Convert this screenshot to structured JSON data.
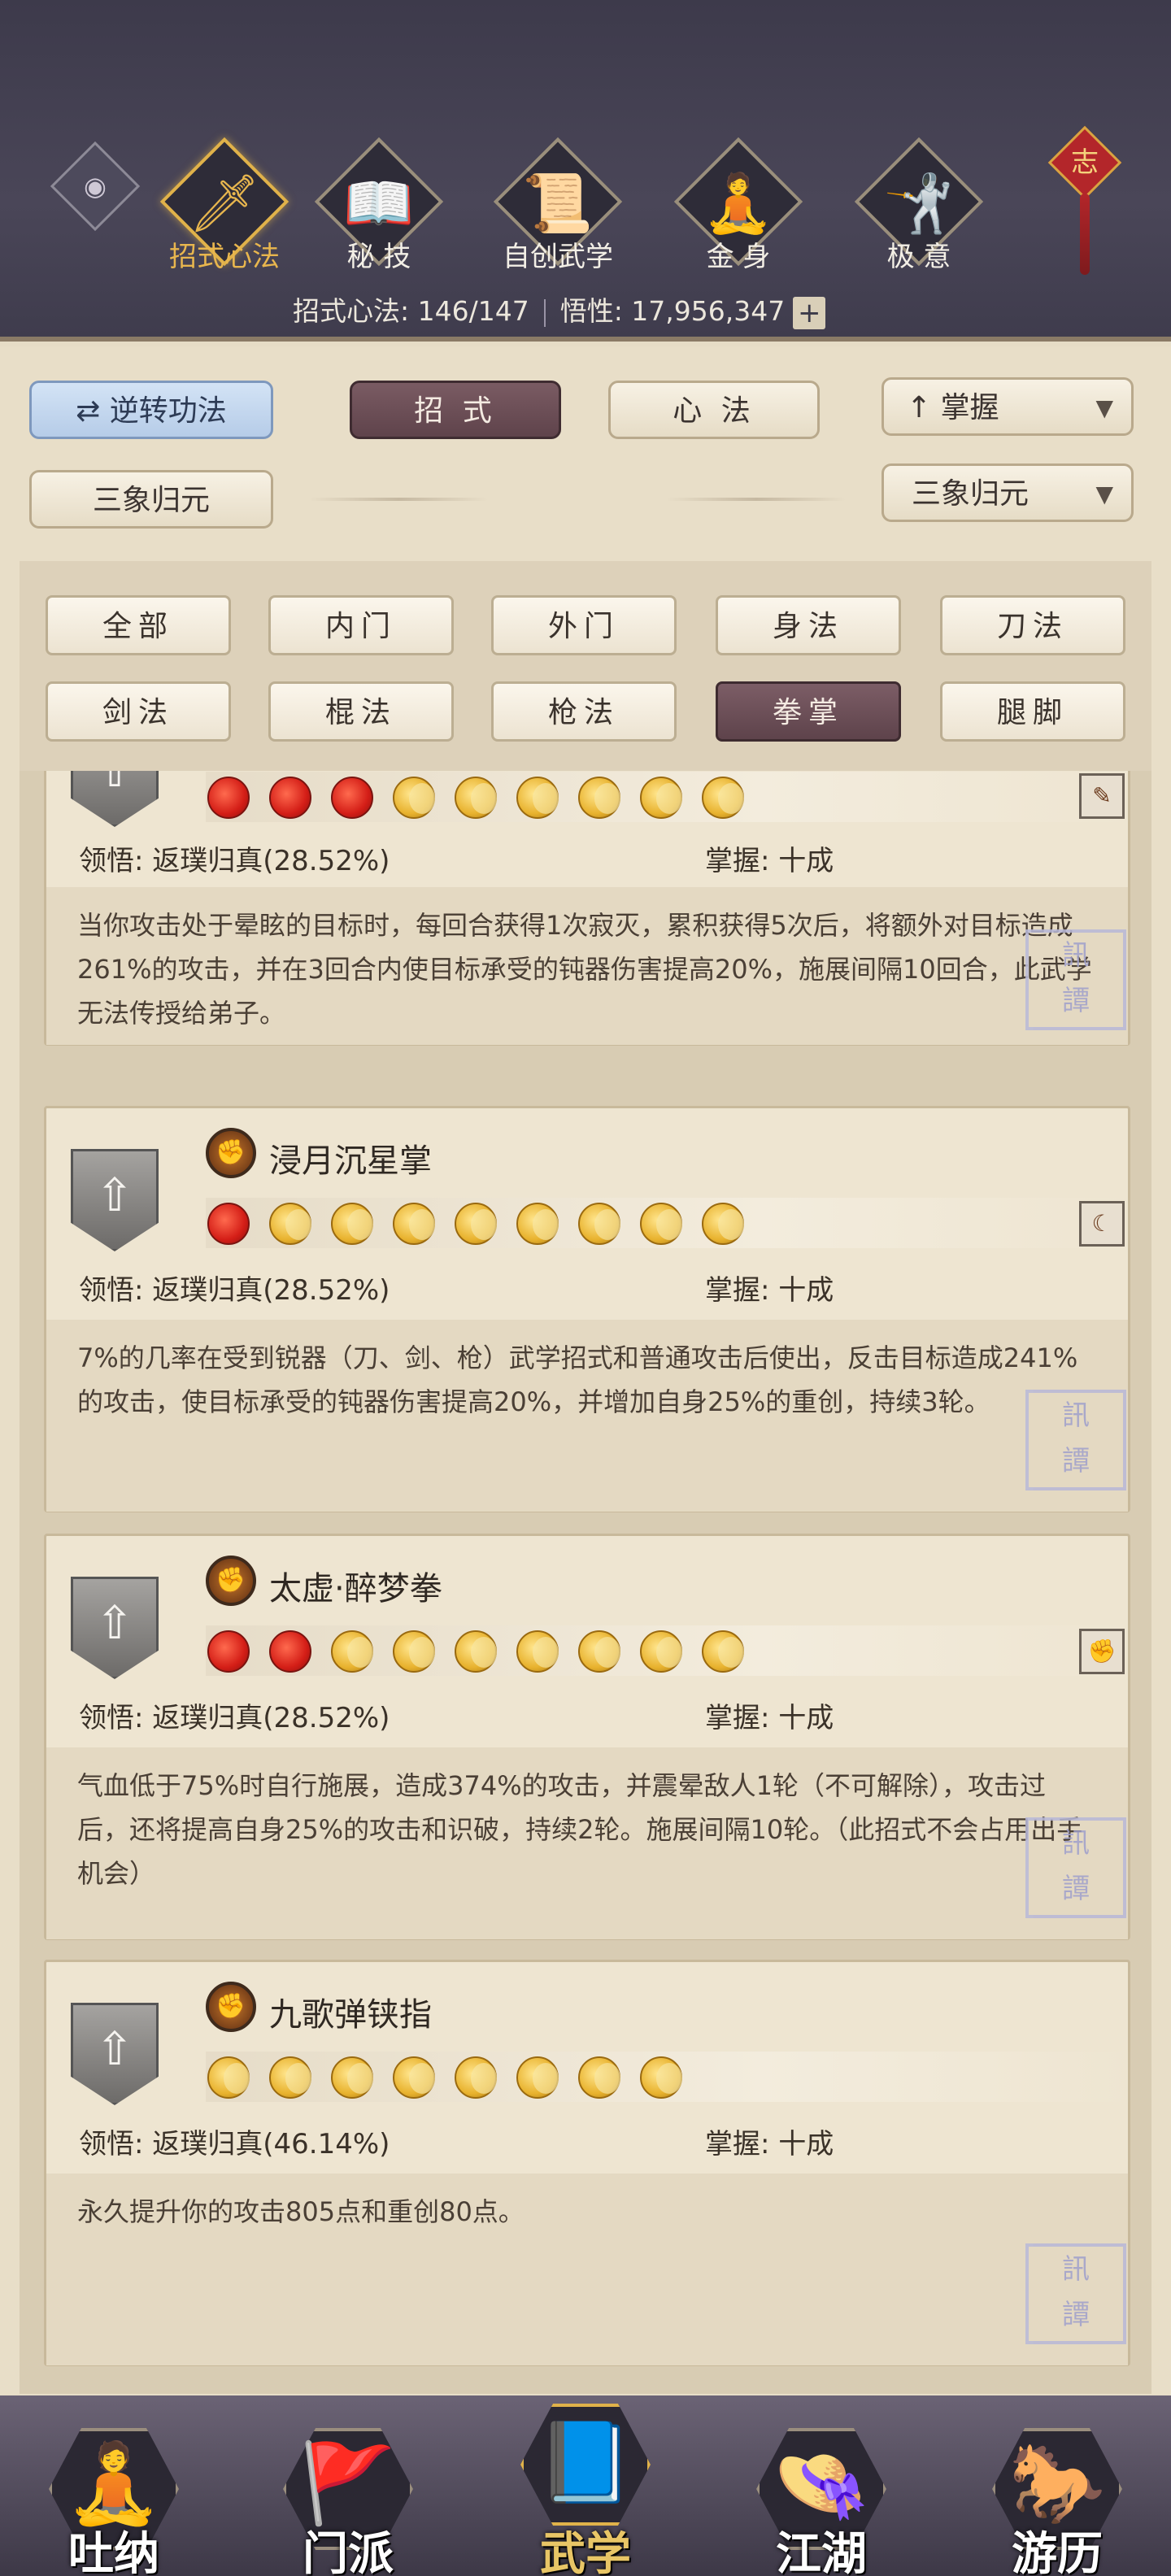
{
  "header": {
    "tabs": [
      {
        "label": "招式心法",
        "icon": "sword-icon"
      },
      {
        "label": "秘 技",
        "icon": "book-icon"
      },
      {
        "label": "自创武学",
        "icon": "scroll-icon"
      },
      {
        "label": "金 身",
        "icon": "meditating-figure-icon"
      },
      {
        "label": "极 意",
        "icon": "martial-pose-icon"
      }
    ],
    "knot_text": "志",
    "stats_moves_label": "招式心法: 146/147",
    "stats_insight_label": "悟性: 17,956,347",
    "plus_label": "+"
  },
  "controls": {
    "reverse_label": "逆转功法",
    "moves_label": "招 式",
    "heart_label": "心 法",
    "sort_label": "掌握",
    "mode_label": "三象归元",
    "mode_select_label": "三象归元"
  },
  "filters": [
    "全部",
    "内门",
    "外门",
    "身法",
    "刀法",
    "剑法",
    "棍法",
    "枪法",
    "拳掌",
    "腿脚"
  ],
  "cards": [
    {
      "name": "",
      "red": 3,
      "gold": 6,
      "corner_icon": "feather-icon",
      "insight": "领悟:  返璞归真(28.52%)",
      "mastery": "掌握:  十成",
      "desc": "当你攻击处于晕眩的目标时，每回合获得1次寂灭，累积获得5次后，将额外对目标造成261%的攻击，并在3回合内使目标承受的钝器伤害提高20%，施展间隔10回合，此武学无法传授给弟子。"
    },
    {
      "name": "浸月沉星掌",
      "red": 1,
      "gold": 8,
      "corner_icon": "moon-icon",
      "insight": "领悟:  返璞归真(28.52%)",
      "mastery": "掌握:  十成",
      "desc": "7%的几率在受到锐器（刀、剑、枪）武学招式和普通攻击后使出，反击目标造成241%的攻击，使目标承受的钝器伤害提高20%，并增加自身25%的重创，持续3轮。"
    },
    {
      "name": "太虚·醉梦拳",
      "red": 2,
      "gold": 7,
      "corner_icon": "fist-icon",
      "insight": "领悟:  返璞归真(28.52%)",
      "mastery": "掌握:  十成",
      "desc": "气血低于75%时自行施展，造成374%的攻击，并震晕敌人1轮（不可解除），攻击过后，还将提高自身25%的攻击和识破，持续2轮。施展间隔10轮。（此招式不会占用出手机会）"
    },
    {
      "name": "九歌弹铗指",
      "red": 0,
      "gold": 8,
      "corner_icon": "",
      "insight": "领悟:  返璞归真(46.14%)",
      "mastery": "掌握:  十成",
      "desc": "永久提升你的攻击805点和重创80点。"
    }
  ],
  "nav": [
    {
      "label": "吐纳",
      "icon": "monk-icon"
    },
    {
      "label": "门派",
      "icon": "banner-icon"
    },
    {
      "label": "武学",
      "icon": "manual-icon"
    },
    {
      "label": "江湖",
      "icon": "straw-hat-icon"
    },
    {
      "label": "游历",
      "icon": "horse-icon"
    }
  ]
}
